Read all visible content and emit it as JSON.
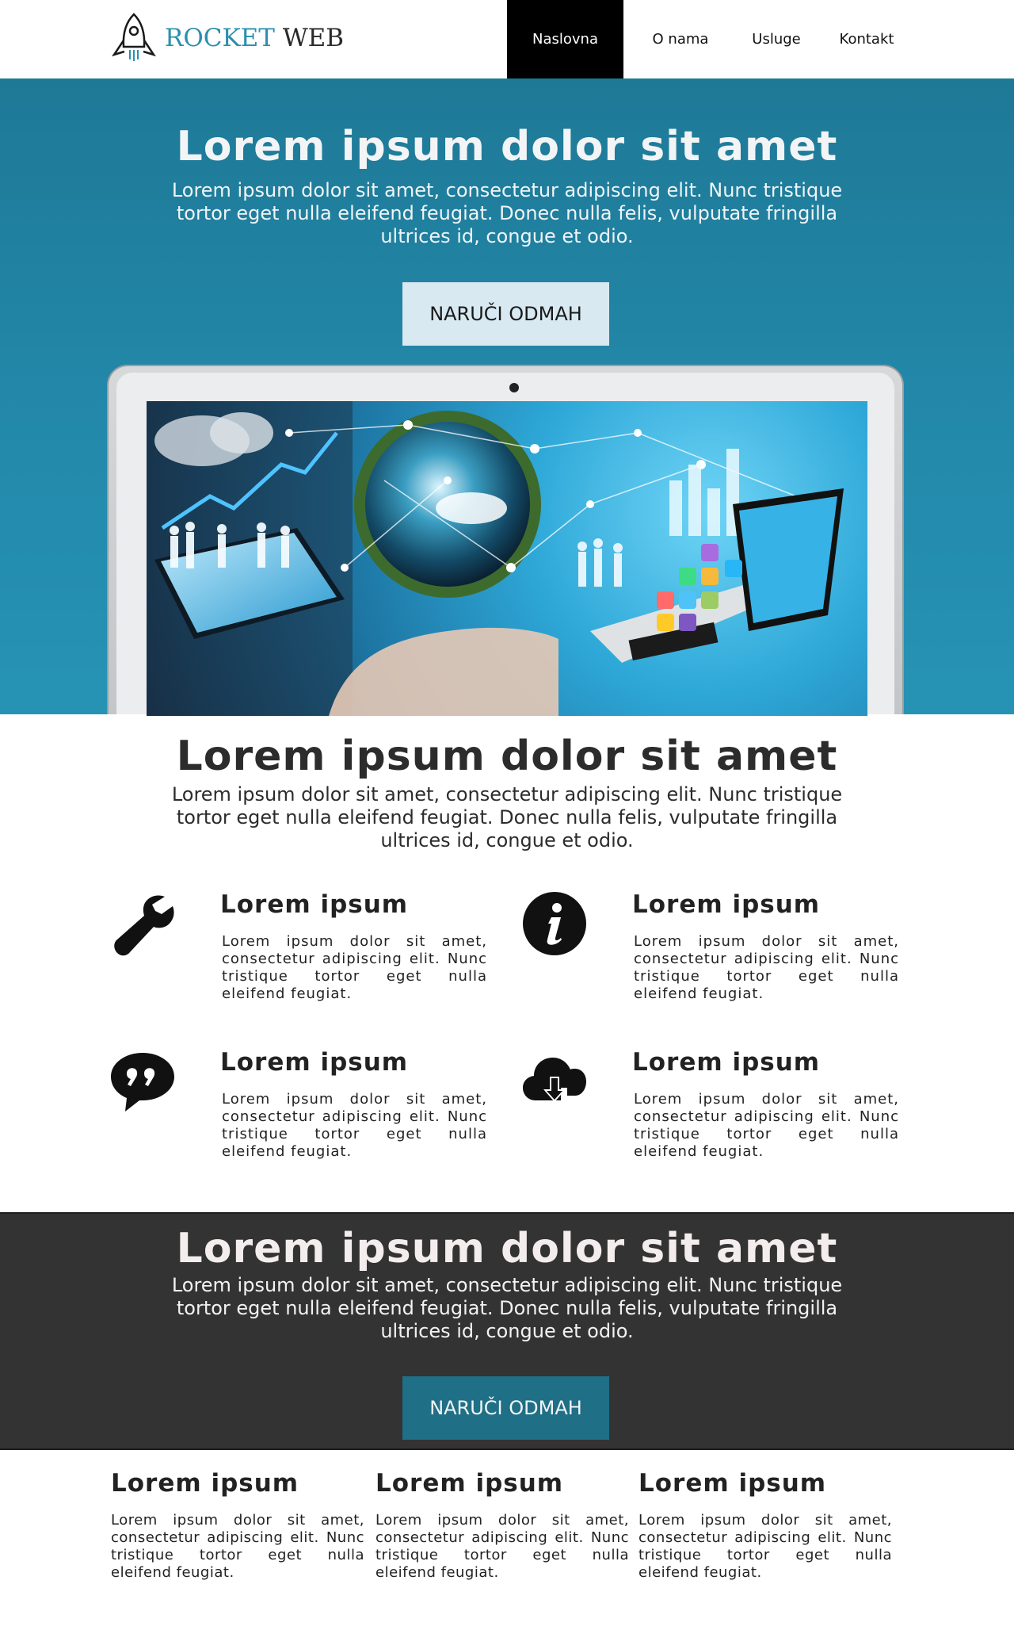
{
  "brand": {
    "name_part1": "ROCKET",
    "name_part2": "WEB"
  },
  "nav": {
    "items": [
      {
        "label": "Naslovna"
      },
      {
        "label": "O nama"
      },
      {
        "label": "Usluge"
      },
      {
        "label": "Kontakt"
      }
    ]
  },
  "hero": {
    "title": "Lorem ipsum dolor sit amet",
    "text": "Lorem ipsum dolor sit amet, consectetur adipiscing elit. Nunc tristique tortor eget nulla eleifend feugiat. Donec nulla felis, vulputate fringilla ultrices id, congue et odio.",
    "cta": "NARUČI ODMAH"
  },
  "section2": {
    "title": "Lorem ipsum dolor sit amet",
    "text": "Lorem ipsum dolor sit amet, consectetur adipiscing elit. Nunc tristique tortor eget nulla eleifend feugiat. Donec nulla felis, vulputate fringilla ultrices id, congue et odio."
  },
  "features": [
    {
      "icon": "wrench-icon",
      "title": "Lorem ipsum",
      "text": "Lorem ipsum dolor sit amet, consectetur adipiscing elit. Nunc tristique tortor eget nulla eleifend feugiat."
    },
    {
      "icon": "info-icon",
      "title": "Lorem ipsum",
      "text": "Lorem ipsum dolor sit amet, consectetur adipiscing elit. Nunc tristique tortor eget nulla eleifend feugiat."
    },
    {
      "icon": "quote-bubble-icon",
      "title": "Lorem ipsum",
      "text": "Lorem ipsum dolor sit amet, consectetur adipiscing elit. Nunc tristique tortor eget nulla eleifend feugiat."
    },
    {
      "icon": "cloud-download-icon",
      "title": "Lorem ipsum",
      "text": "Lorem ipsum dolor sit amet, consectetur adipiscing elit. Nunc tristique tortor eget nulla eleifend feugiat."
    }
  ],
  "cta_dark": {
    "title": "Lorem ipsum dolor sit amet",
    "text": "Lorem ipsum dolor sit amet, consectetur adipiscing elit. Nunc tristique tortor eget nulla eleifend feugiat. Donec nulla felis, vulputate fringilla ultrices id, congue et odio.",
    "cta": "NARUČI ODMAH"
  },
  "footer_columns": [
    {
      "title": "Lorem ipsum",
      "text": "Lorem ipsum dolor sit amet, consectetur adipiscing elit. Nunc tristique tortor eget nulla eleifend feugiat."
    },
    {
      "title": "Lorem ipsum",
      "text": "Lorem ipsum dolor sit amet, consectetur adipiscing elit. Nunc tristique tortor eget nulla eleifend feugiat."
    },
    {
      "title": "Lorem ipsum",
      "text": "Lorem ipsum dolor sit amet, consectetur adipiscing elit. Nunc tristique tortor eget nulla eleifend feugiat."
    }
  ],
  "colors": {
    "hero_bg": "#2389ab",
    "accent": "#2a8fb0",
    "nav_active_bg": "#000000",
    "dark_bg": "#333333",
    "teal_button": "#1f6f86",
    "light_button": "#d8e9f1"
  }
}
